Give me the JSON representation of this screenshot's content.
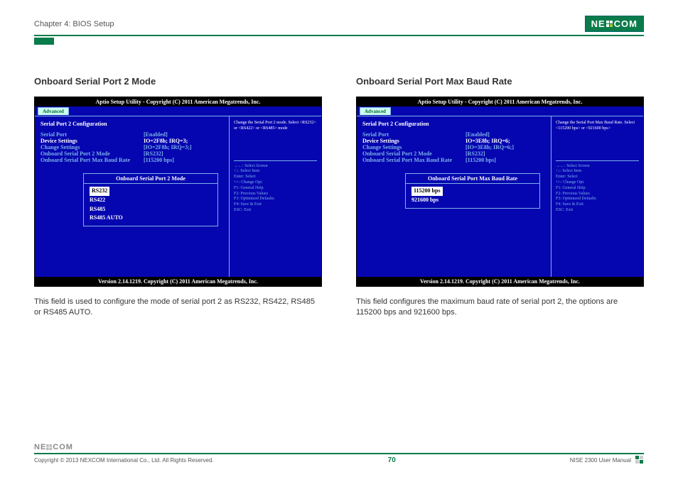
{
  "header": {
    "chapter": "Chapter 4: BIOS Setup",
    "logo": "NE COM"
  },
  "left": {
    "title": "Onboard Serial Port 2 Mode",
    "bios": {
      "top": "Aptio Setup Utility - Copyright (C) 2011 American Megatrends, Inc.",
      "tab": "Advanced",
      "heading": "Serial Port 2 Configuration",
      "rows": [
        {
          "label": "Serial Port",
          "value": "[Enabled]",
          "cls": "bios-cyan"
        },
        {
          "label": "Device Settings",
          "value": "IO=2F8h; IRQ=3;",
          "cls": "bios-white"
        },
        {
          "label": " ",
          "value": " ",
          "cls": ""
        },
        {
          "label": "Change Settings",
          "value": "[IO=2F8h; IRQ=3;]",
          "cls": "bios-cyan"
        },
        {
          "label": "Onboard Serial Port 2 Mode",
          "value": "[RS232]",
          "cls": "bios-cyan"
        },
        {
          "label": "Onboard Serial Port Max Baud Rate",
          "value": "[115200 bps]",
          "cls": "bios-cyan"
        }
      ],
      "popup": {
        "title": "Onboard Serial Port 2 Mode",
        "items": [
          "RS232",
          "RS422",
          "RS485",
          "RS485 AUTO"
        ],
        "selected": "RS232"
      },
      "help": "Change the Serial Port 2 mode. Select <RS232> or <RS422> or <RS485> mode",
      "keys": [
        "→←: Select Screen",
        "↑↓: Select Item",
        "Enter: Select",
        "+/-: Change Opt.",
        "F1: General Help",
        "F2: Previous Values",
        "F3: Optimized Defaults",
        "F4: Save & Exit",
        "ESC: Exit"
      ],
      "bottom": "Version 2.14.1219. Copyright (C) 2011 American Megatrends, Inc."
    },
    "desc": "This field is used to configure the mode of serial port 2 as RS232, RS422, RS485 or RS485 AUTO."
  },
  "right": {
    "title": "Onboard Serial Port Max Baud Rate",
    "bios": {
      "top": "Aptio Setup Utility - Copyright (C) 2011 American Megatrends, Inc.",
      "tab": "Advanced",
      "heading": "Serial Port 2 Configuration",
      "rows": [
        {
          "label": "Serial Port",
          "value": "[Enabled]",
          "cls": "bios-cyan"
        },
        {
          "label": "Device Settings",
          "value": "IO=3E8h; IRQ=6;",
          "cls": "bios-white"
        },
        {
          "label": " ",
          "value": " ",
          "cls": ""
        },
        {
          "label": "Change Settings",
          "value": "[IO=3E8h; IRQ=6;]",
          "cls": "bios-cyan"
        },
        {
          "label": "Onboard Serial Port 2 Mode",
          "value": "[RS232]",
          "cls": "bios-cyan"
        },
        {
          "label": "Onboard Serial Port Max Baud Rate",
          "value": "[115200 bps]",
          "cls": "bios-cyan"
        }
      ],
      "popup": {
        "title": "Onboard Serial Port Max Baud Rate",
        "items": [
          "115200 bps",
          "921600 bps"
        ],
        "selected": "115200 bps"
      },
      "help": "Change the Serial Port Max Baud Rate. Select <115200 bps> or <921600 bps>",
      "keys": [
        "→←: Select Screen",
        "↑↓: Select Item",
        "Enter: Select",
        "+/-: Change Opt.",
        "F1: General Help",
        "F2: Previous Values",
        "F3: Optimized Defaults",
        "F4: Save & Exit",
        "ESC: Exit"
      ],
      "bottom": "Version 2.14.1219. Copyright (C) 2011 American Megatrends, Inc."
    },
    "desc": "This field configures the maximum baud rate of serial port 2, the options are 115200 bps and 921600 bps."
  },
  "footer": {
    "copyright": "Copyright © 2013 NEXCOM International Co., Ltd. All Rights Reserved.",
    "page": "70",
    "manual": "NISE 2300 User Manual"
  }
}
